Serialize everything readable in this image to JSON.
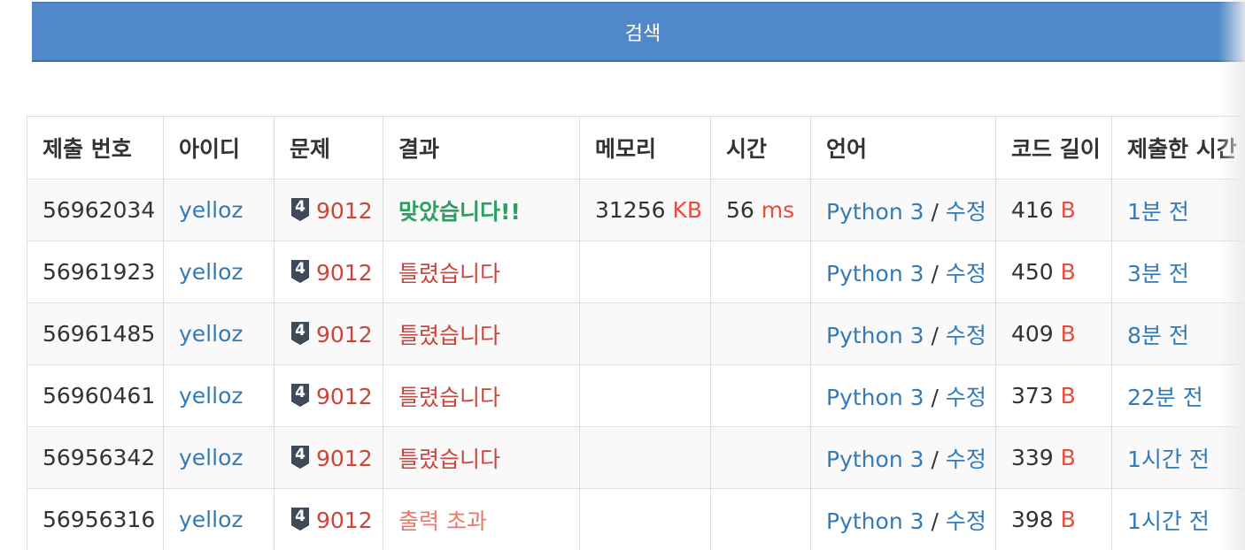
{
  "search_button": {
    "label": "검색"
  },
  "colors": {
    "accent": "#5189c8",
    "link": "#337ab7",
    "problem": "#c9463d",
    "accepted": "#2f9e61",
    "output_exceeded": "#e8786a"
  },
  "table": {
    "headers": [
      "제출 번호",
      "아이디",
      "문제",
      "결과",
      "메모리",
      "시간",
      "언어",
      "코드 길이",
      "제출한 시간"
    ],
    "rows": [
      {
        "id": "56962034",
        "user": "yelloz",
        "tier": "4",
        "problem": "9012",
        "result": "맞았습니다!!",
        "result_type": "accepted",
        "memory": "31256",
        "memory_unit": "KB",
        "time": "56",
        "time_unit": "ms",
        "lang": "Python 3",
        "edit": "수정",
        "code_len": "416",
        "code_unit": "B",
        "submitted": "1분 전"
      },
      {
        "id": "56961923",
        "user": "yelloz",
        "tier": "4",
        "problem": "9012",
        "result": "틀렸습니다",
        "result_type": "wrong",
        "memory": "",
        "memory_unit": "",
        "time": "",
        "time_unit": "",
        "lang": "Python 3",
        "edit": "수정",
        "code_len": "450",
        "code_unit": "B",
        "submitted": "3분 전"
      },
      {
        "id": "56961485",
        "user": "yelloz",
        "tier": "4",
        "problem": "9012",
        "result": "틀렸습니다",
        "result_type": "wrong",
        "memory": "",
        "memory_unit": "",
        "time": "",
        "time_unit": "",
        "lang": "Python 3",
        "edit": "수정",
        "code_len": "409",
        "code_unit": "B",
        "submitted": "8분 전"
      },
      {
        "id": "56960461",
        "user": "yelloz",
        "tier": "4",
        "problem": "9012",
        "result": "틀렸습니다",
        "result_type": "wrong",
        "memory": "",
        "memory_unit": "",
        "time": "",
        "time_unit": "",
        "lang": "Python 3",
        "edit": "수정",
        "code_len": "373",
        "code_unit": "B",
        "submitted": "22분 전"
      },
      {
        "id": "56956342",
        "user": "yelloz",
        "tier": "4",
        "problem": "9012",
        "result": "틀렸습니다",
        "result_type": "wrong",
        "memory": "",
        "memory_unit": "",
        "time": "",
        "time_unit": "",
        "lang": "Python 3",
        "edit": "수정",
        "code_len": "339",
        "code_unit": "B",
        "submitted": "1시간 전"
      },
      {
        "id": "56956316",
        "user": "yelloz",
        "tier": "4",
        "problem": "9012",
        "result": "출력 초과",
        "result_type": "output_exceeded",
        "memory": "",
        "memory_unit": "",
        "time": "",
        "time_unit": "",
        "lang": "Python 3",
        "edit": "수정",
        "code_len": "398",
        "code_unit": "B",
        "submitted": "1시간 전"
      }
    ]
  }
}
